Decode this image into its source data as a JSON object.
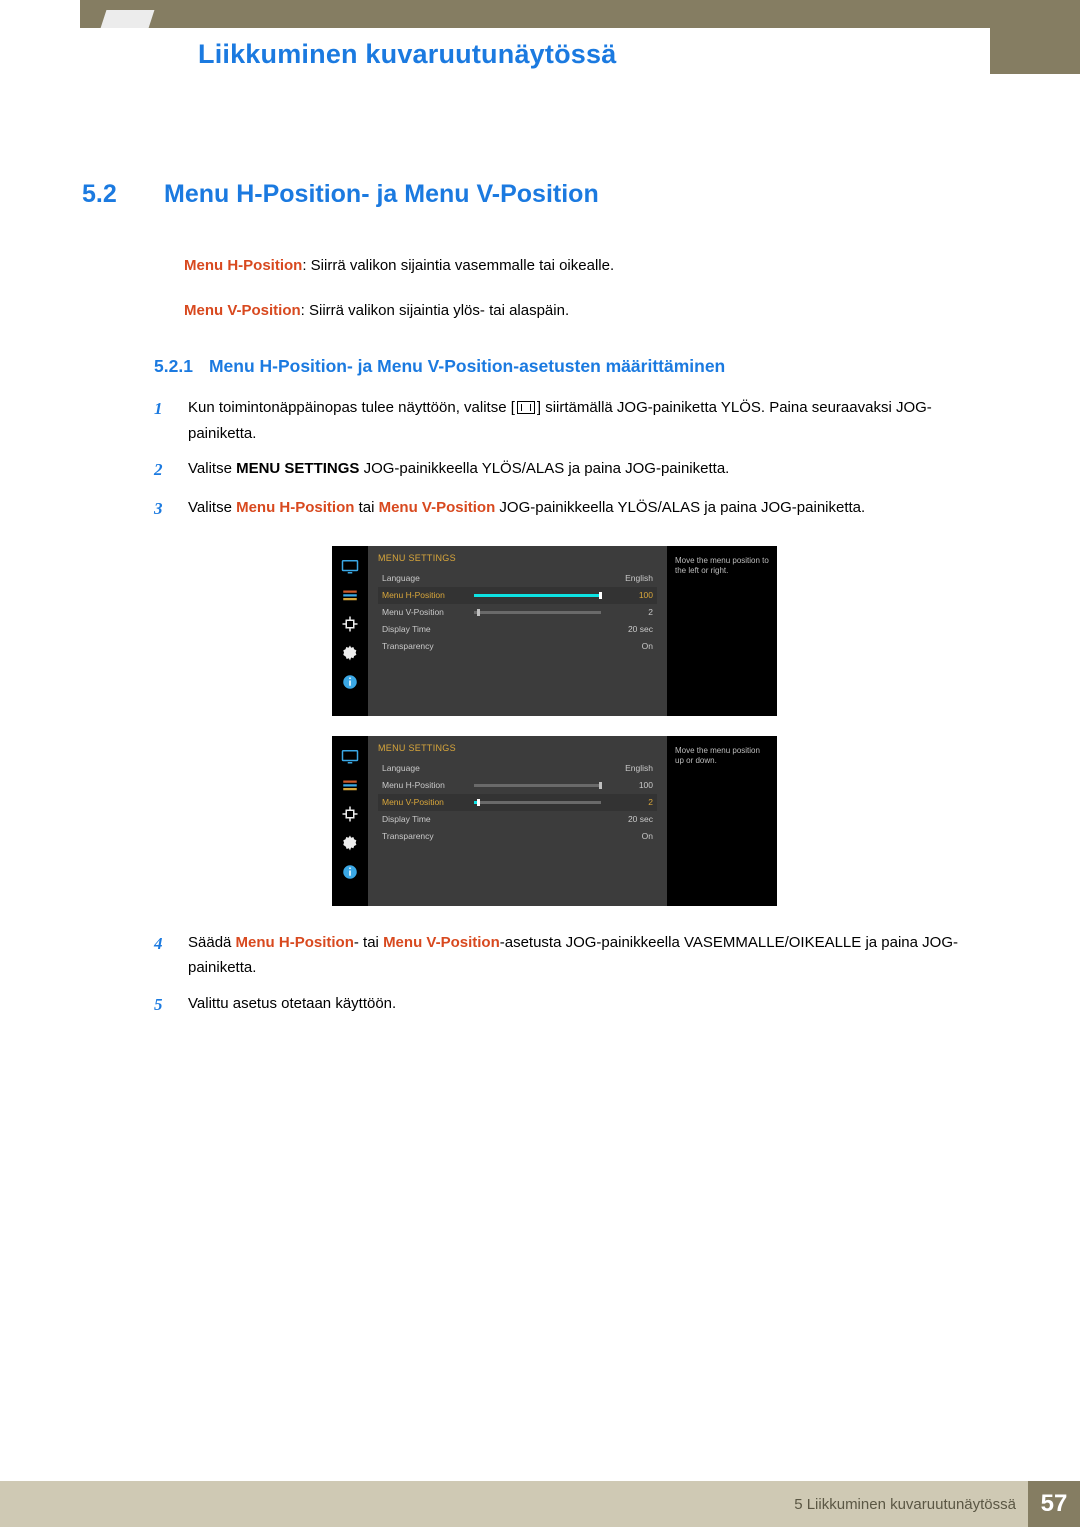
{
  "header": {
    "page_title": "Liikkuminen kuvaruutunäytössä"
  },
  "section": {
    "number": "5.2",
    "title": "Menu H-Position- ja Menu V-Position"
  },
  "definitions": [
    {
      "term": "Menu H-Position",
      "desc": ": Siirrä valikon sijaintia vasemmalle tai oikealle."
    },
    {
      "term": "Menu V-Position",
      "desc": ": Siirrä valikon sijaintia ylös- tai alaspäin."
    }
  ],
  "subsection": {
    "number": "5.2.1",
    "title": "Menu H-Position- ja Menu V-Position-asetusten määrittäminen"
  },
  "steps": {
    "s1a": "Kun toimintonäppäinopas tulee näyttöön, valitse [",
    "s1b": "] siirtämällä JOG-painiketta YLÖS. Paina seuraavaksi JOG-painiketta.",
    "s2a": "Valitse ",
    "s2b": "MENU SETTINGS",
    "s2c": " JOG-painikkeella YLÖS/ALAS ja paina JOG-painiketta.",
    "s3a": "Valitse ",
    "s3b": "Menu H-Position",
    "s3c": " tai ",
    "s3d": "Menu V-Position",
    "s3e": " JOG-painikkeella YLÖS/ALAS ja paina JOG-painiketta.",
    "s4a": "Säädä ",
    "s4b": "Menu H-Position",
    "s4c": "- tai ",
    "s4d": "Menu V-Position",
    "s4e": "-asetusta JOG-painikkeella VASEMMALLE/OIKEALLE ja paina JOG-painiketta.",
    "s5": "Valittu asetus otetaan käyttöön."
  },
  "osd": {
    "title": "MENU SETTINGS",
    "rows": {
      "language": {
        "label": "Language",
        "value": "English"
      },
      "hpos": {
        "label": "Menu H-Position",
        "value": "100"
      },
      "vpos": {
        "label": "Menu V-Position",
        "value": "2"
      },
      "dtime": {
        "label": "Display Time",
        "value": "20 sec"
      },
      "transp": {
        "label": "Transparency",
        "value": "On"
      }
    },
    "help_h": "Move the menu position to the left or right.",
    "help_v": "Move the menu position up or down."
  },
  "footer": {
    "text": "5 Liikkuminen kuvaruutunäytössä",
    "page": "57"
  }
}
